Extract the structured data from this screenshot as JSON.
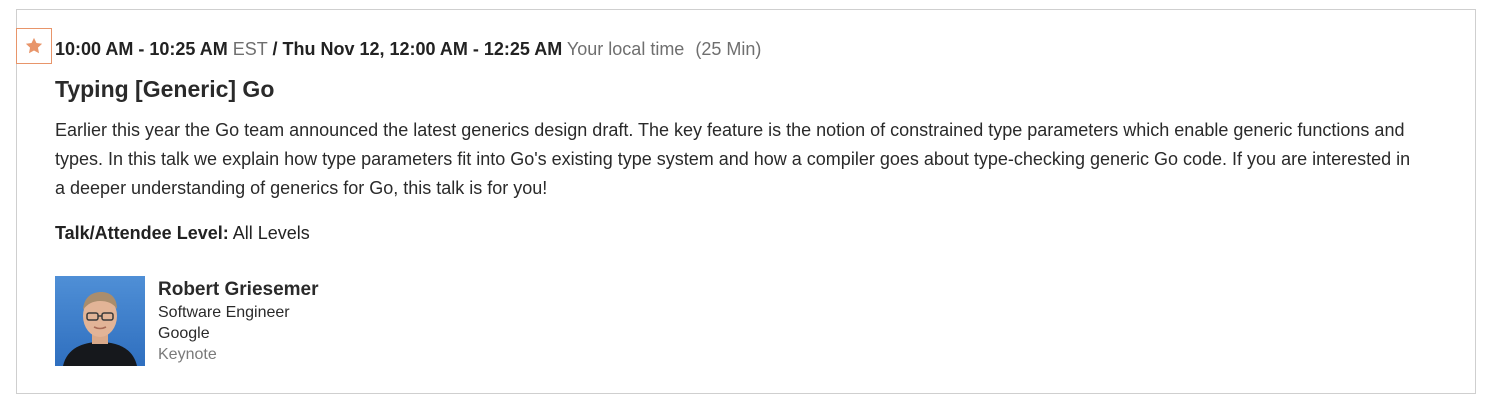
{
  "session": {
    "time_est": "10:00 AM - 10:25 AM",
    "tz_est": "EST",
    "separator": "/",
    "time_local": "Thu Nov 12, 12:00 AM - 12:25 AM",
    "local_label": "Your local time",
    "duration": "(25 Min)",
    "title": "Typing [Generic] Go",
    "description": "Earlier this year the Go team announced the latest generics design draft. The key feature is the notion of constrained type parameters which enable generic functions and types. In this talk we explain how type parameters fit into Go's existing type system and how a compiler goes about type-checking generic Go code. If you are interested in a deeper understanding of generics for Go, this talk is for you!",
    "level_label": "Talk/Attendee Level:",
    "level_value": "All Levels",
    "favorite_icon": "star-icon",
    "favorite_color": "#e8956a"
  },
  "speaker": {
    "name": "Robert Griesemer",
    "title": "Software Engineer",
    "company": "Google",
    "type": "Keynote"
  }
}
